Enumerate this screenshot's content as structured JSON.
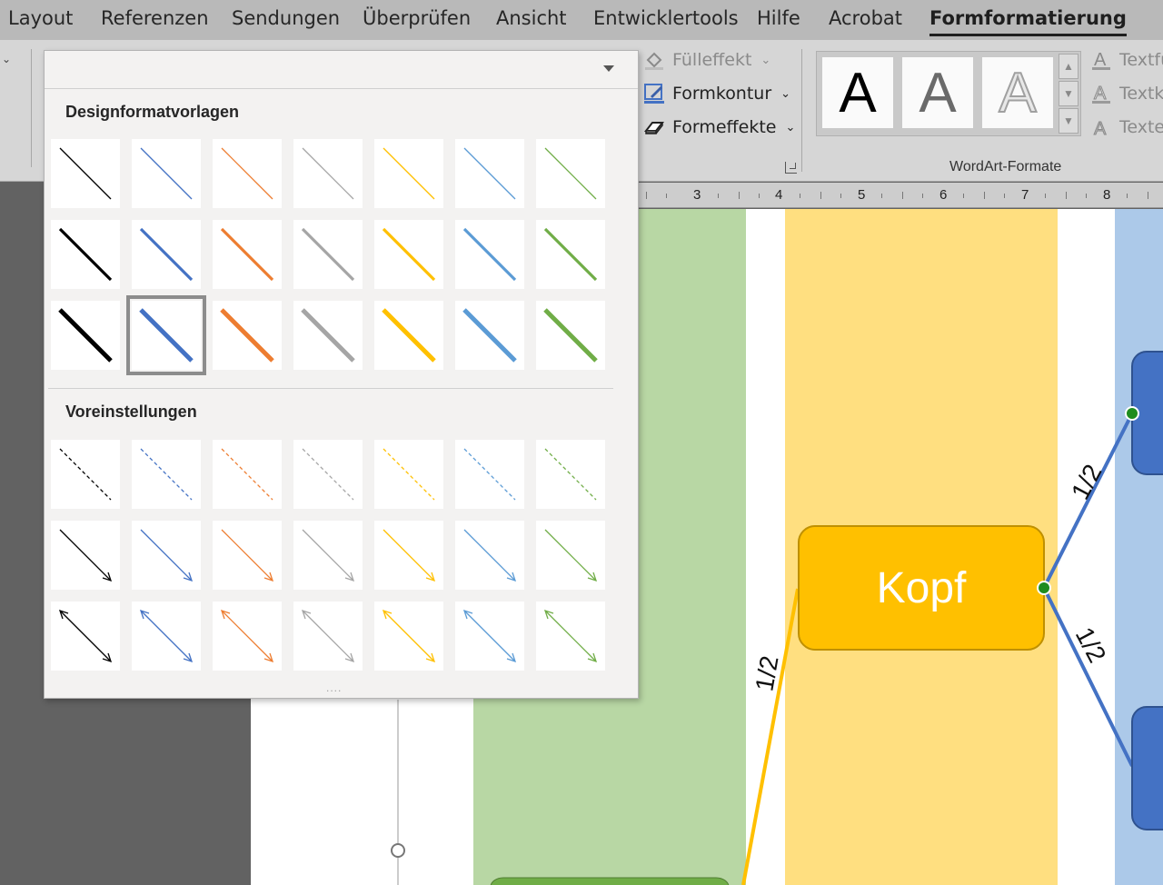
{
  "tabs": [
    {
      "label": "Layout",
      "active": false
    },
    {
      "label": "Referenzen",
      "active": false
    },
    {
      "label": "Sendungen",
      "active": false
    },
    {
      "label": "Überprüfen",
      "active": false
    },
    {
      "label": "Ansicht",
      "active": false
    },
    {
      "label": "Entwicklertools",
      "active": false
    },
    {
      "label": "Hilfe",
      "active": false
    },
    {
      "label": "Acrobat",
      "active": false
    },
    {
      "label": "Formformatierung",
      "active": true
    }
  ],
  "shape_styles": {
    "fill_label": "Fülleffekt",
    "outline_label": "Formkontur",
    "effects_label": "Formeffekte"
  },
  "wordart": {
    "group_label": "WordArt-Formate",
    "tile_letter": "A",
    "text_fill_label": "Textfü",
    "text_outline_label": "Textko",
    "text_effects_label": "Textef"
  },
  "ruler_numbers": [
    "3",
    "4",
    "5",
    "6",
    "7",
    "8"
  ],
  "gallery": {
    "theme_title": "Designformatvorlagen",
    "preset_title": "Voreinstellungen",
    "colors": [
      "#000000",
      "#4472c4",
      "#ed7d31",
      "#a5a5a5",
      "#ffc000",
      "#5b9bd5",
      "#70ad47"
    ],
    "theme_rows": [
      {
        "weight": "thin",
        "selected_index": -1
      },
      {
        "weight": "medium",
        "selected_index": -1
      },
      {
        "weight": "thick",
        "selected_index": 1
      }
    ],
    "preset_rows": [
      "dashed",
      "arrow",
      "double-arrow"
    ]
  },
  "diagram": {
    "head_label": "Kopf",
    "edge_labels": [
      "1/2",
      "1/2",
      "1/2"
    ],
    "colors": {
      "lane_green": "#b8d7a4",
      "lane_yellow": "#ffdf80",
      "lane_blue": "#acc9e9",
      "node_yellow": "#ffc000",
      "node_blue": "#4472c4",
      "line_blue": "#4472c4",
      "line_yellow": "#ffc000",
      "handle_green": "#2e8b2e"
    }
  }
}
